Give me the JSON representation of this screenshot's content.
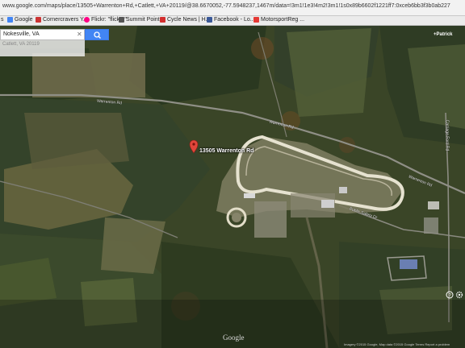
{
  "browser": {
    "url": "www.google.com/maps/place/13505+Warrenton+Rd,+Catlett,+VA+20119/@38.6670052,-77.5948237,1467m/data=!3m1!1e3!4m2!3m1!1s0x89b6602f1221ff7:0xceb6bb3f3b0ab227",
    "bookmarks": [
      {
        "label": "Google",
        "color": "#4285f4"
      },
      {
        "label": "Cornercravers Y...",
        "color": "#cc3333"
      },
      {
        "label": "Flickr: \"flicker\"",
        "color": "#ff0084"
      },
      {
        "label": "Summit Point ...",
        "color": "#555555"
      },
      {
        "label": "Cycle News | H...",
        "color": "#d32f2f"
      },
      {
        "label": "Facebook - Lo...",
        "color": "#3b5998"
      },
      {
        "label": "MotorsportReg ...",
        "color": "#e53935"
      }
    ],
    "bookmarks_prefix": "s"
  },
  "search": {
    "value": "Nokesville, VA",
    "suggestion": "Catlett, VA 20119",
    "button_color": "#4285f4"
  },
  "account": {
    "label": "+Patrick"
  },
  "map": {
    "pin_label": "13505 Warrenton Rd",
    "roads": {
      "warrenton_top": "Warrenton Rd",
      "warrenton_mid": "Warrenton Rd",
      "warrenton_right": "Warrenton Rd",
      "public_safety": "Public Safety Dr",
      "vertical": "Carriage Ford Rd"
    },
    "logo": "Google",
    "footer": "Imagery ©2015 Google, Map data ©2015 Google    Terms    Report a problem"
  }
}
